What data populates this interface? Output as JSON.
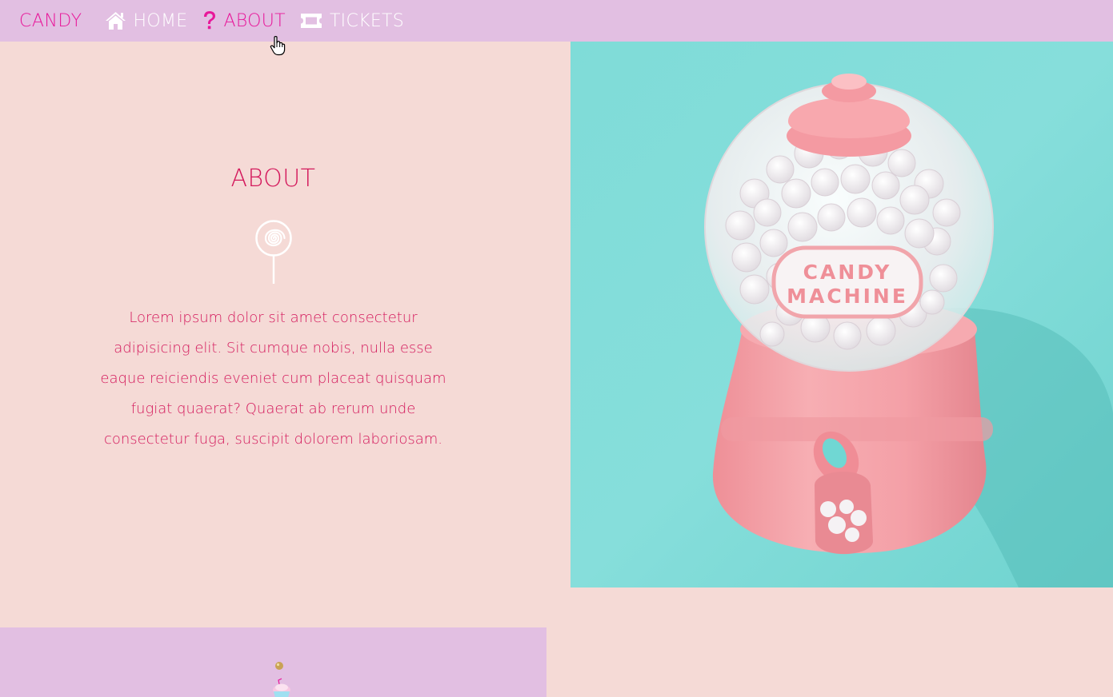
{
  "nav": {
    "brand": "CANDY",
    "items": [
      {
        "label": "HOME",
        "icon": "home-icon"
      },
      {
        "label": "ABOUT",
        "icon": "question-icon",
        "active": true
      },
      {
        "label": "TICKETS",
        "icon": "ticket-icon"
      }
    ]
  },
  "about": {
    "title": "ABOUT",
    "icon": "lollipop-icon",
    "text": "Lorem ipsum dolor sit amet consectetur adipisicing elit. Sit cumque nobis, nulla esse eaque reiciendis eveniet cum placeat quisquam fugiat quaerat? Quaerat ab rerum unde consectetur fuga, suscipit dolorem laboriosam."
  },
  "photo": {
    "label_line1": "CANDY",
    "label_line2": "MACHINE"
  },
  "colors": {
    "nav_background": "#e2bfe2",
    "page_background": "#f5dad6",
    "accent_pink": "#e8179a",
    "title_red": "#d4195c",
    "photo_background": "#7fdcd8",
    "machine_pink": "#f4a0a6"
  }
}
